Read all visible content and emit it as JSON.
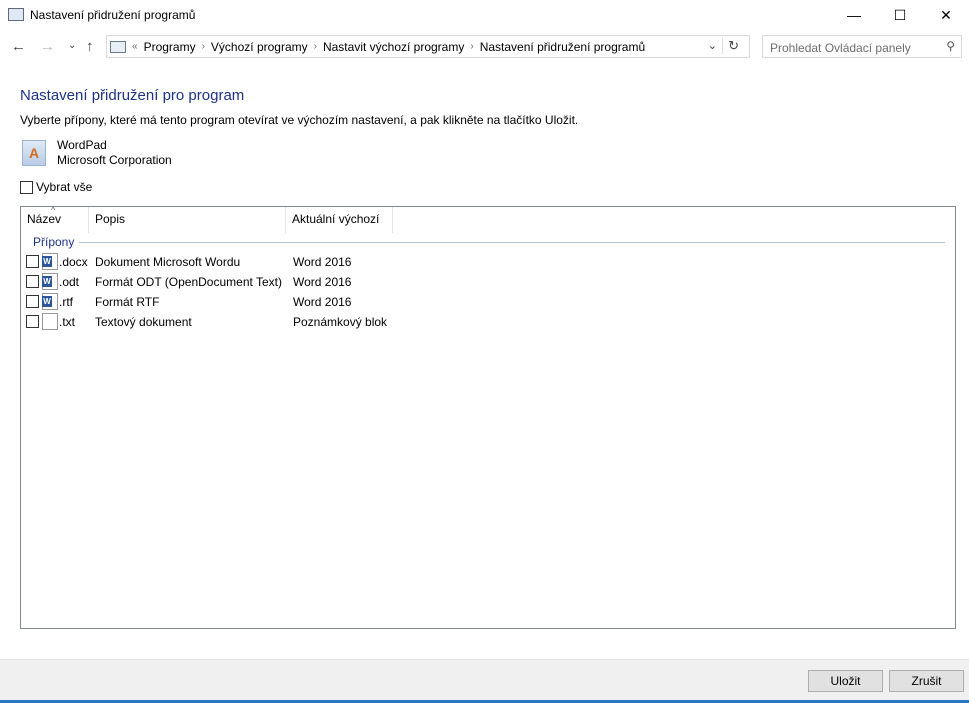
{
  "window": {
    "title": "Nastavení přidružení programů",
    "minimize": "—",
    "maximize": "☐",
    "close": "✕"
  },
  "nav": {
    "back": "←",
    "forward": "→",
    "recent": "⌄",
    "up": "↑",
    "breadcrumb": [
      "Programy",
      "Výchozí programy",
      "Nastavit výchozí programy",
      "Nastavení přidružení programů"
    ],
    "overflow": "«",
    "search_placeholder": "Prohledat Ovládací panely"
  },
  "main": {
    "heading": "Nastavení přidružení pro program",
    "description": "Vyberte přípony, které má tento program otevírat ve výchozím nastavení, a pak klikněte na tlačítko Uložit.",
    "program_name": "WordPad",
    "program_company": "Microsoft Corporation",
    "select_all": "Vybrat vše"
  },
  "list": {
    "columns": [
      "Název",
      "Popis",
      "Aktuální výchozí"
    ],
    "group": "Přípony",
    "rows": [
      {
        "ext": ".docx",
        "desc": "Dokument Microsoft Wordu",
        "default": "Word 2016",
        "icon": "word-doc"
      },
      {
        "ext": ".odt",
        "desc": "Formát ODT (OpenDocument Text)",
        "default": "Word 2016",
        "icon": "word-odt"
      },
      {
        "ext": ".rtf",
        "desc": "Formát RTF",
        "default": "Word 2016",
        "icon": "word-rtf"
      },
      {
        "ext": ".txt",
        "desc": "Textový dokument",
        "default": "Poznámkový blok",
        "icon": "text-file"
      }
    ]
  },
  "footer": {
    "save": "Uložit",
    "cancel": "Zrušit"
  }
}
